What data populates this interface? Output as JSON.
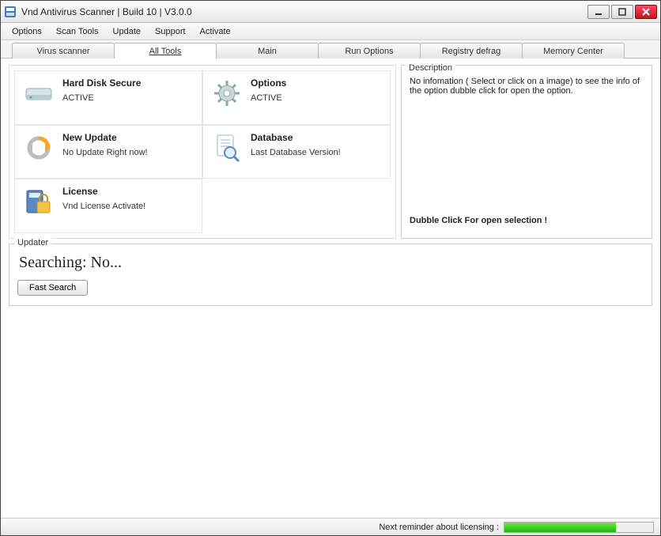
{
  "window": {
    "title": "Vnd Antivirus Scanner | Build 10 | V3.0.0"
  },
  "menu": {
    "items": [
      "Options",
      "Scan Tools",
      "Update",
      "Support",
      "Activate"
    ]
  },
  "tabs": {
    "items": [
      "Virus scanner",
      "All Tools",
      "Main",
      "Run Options",
      "Registry defrag",
      "Memory Center"
    ],
    "active_index": 1
  },
  "tools": [
    {
      "name": "Hard Disk Secure",
      "status": "ACTIVE",
      "icon": "hard-disk-icon"
    },
    {
      "name": "Options",
      "status": "ACTIVE",
      "icon": "gear-icon"
    },
    {
      "name": "New Update",
      "status": "No Update Right now!",
      "icon": "refresh-icon"
    },
    {
      "name": "Database",
      "status": "Last Database Version!",
      "icon": "database-search-icon"
    },
    {
      "name": "License",
      "status": "Vnd License Activate!",
      "icon": "license-lock-icon"
    }
  ],
  "description": {
    "label": "Description",
    "text": "No infomation  ( Select or click on a image) to see the info of the option dubble click for open the option.",
    "footer": "Dubble Click For open selection !"
  },
  "updater": {
    "label": "Updater",
    "status_text": "Searching: No...",
    "button_label": "Fast Search"
  },
  "statusbar": {
    "reminder_label": "Next reminder about licensing :",
    "progress_percent": 75
  }
}
